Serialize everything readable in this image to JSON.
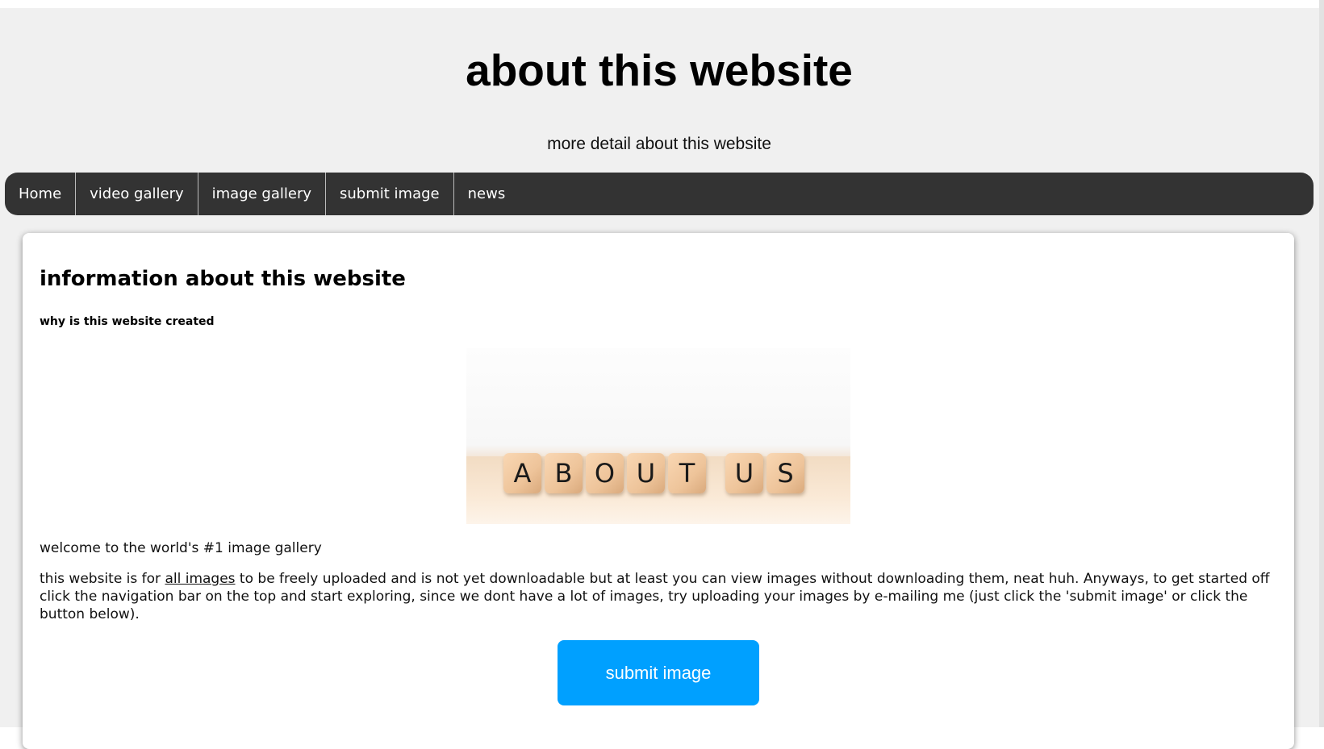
{
  "header": {
    "title": "about this website",
    "subtitle": "more detail about this website"
  },
  "nav": {
    "items": [
      {
        "label": "Home"
      },
      {
        "label": "video gallery"
      },
      {
        "label": "image gallery"
      },
      {
        "label": "submit image"
      },
      {
        "label": "news"
      }
    ]
  },
  "main": {
    "heading": "information about this website",
    "subheading": "why is this website created",
    "image": {
      "letters": [
        "A",
        "B",
        "O",
        "U",
        "T",
        "U",
        "S"
      ]
    },
    "welcome": "welcome to the world's #1 image gallery",
    "body_prefix": "this website is for ",
    "body_link": "all images",
    "body_suffix": " to be freely uploaded and is not yet downloadable but at least you can view images without downloading them, neat huh. Anyways, to get started off click the navigation bar on the top and start exploring, since we dont have a lot of images, try uploading your images by e-mailing me (just click the 'submit image' or click the button below).",
    "button_label": "submit image"
  },
  "colors": {
    "nav_bg": "#333333",
    "button_bg": "#00a0ff",
    "page_bg": "#f0f0f0",
    "card_bg": "#ffffff"
  }
}
